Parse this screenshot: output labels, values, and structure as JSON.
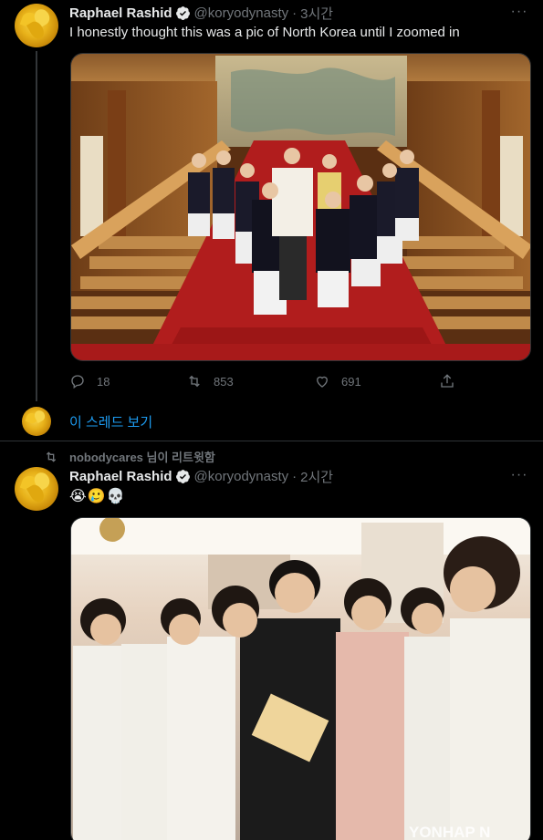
{
  "tweet1": {
    "display_name": "Raphael Rashid",
    "handle": "@koryodynasty",
    "separator": "·",
    "time": "3시간",
    "text": "I honestly thought this was a pic of North Korea until I zoomed in",
    "reply_count": "18",
    "retweet_count": "853",
    "like_count": "691"
  },
  "show_thread": {
    "label": "이 스레드 보기"
  },
  "retweet_banner": {
    "text": "nobodycares 님이 리트윗함"
  },
  "tweet2": {
    "display_name": "Raphael Rashid",
    "handle": "@koryodynasty",
    "separator": "·",
    "time": "2시간",
    "emojis": "😭🥲💀",
    "watermark": "YONHAP N"
  },
  "icons": {
    "more": "more-icon",
    "verified": "verified-badge-icon",
    "reply": "reply-icon",
    "retweet": "retweet-icon",
    "like": "heart-icon",
    "share": "share-icon"
  },
  "colors": {
    "accent": "#1d9bf0",
    "muted": "#71767b",
    "text": "#e7e9ea",
    "background": "#000000"
  }
}
